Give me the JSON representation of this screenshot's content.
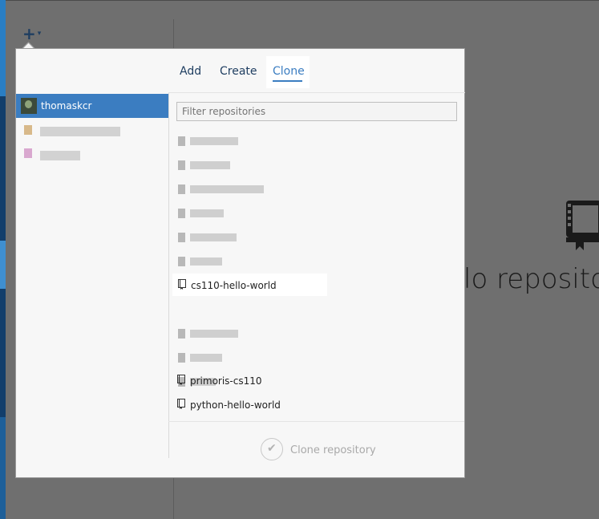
{
  "toolbar": {
    "plus_icon": "+",
    "caret_icon": "▾"
  },
  "background": {
    "partial_text": "lo repositor",
    "icon": "book-icon"
  },
  "tabs": [
    {
      "label": "Add",
      "active": false
    },
    {
      "label": "Create",
      "active": false
    },
    {
      "label": "Clone",
      "active": true
    }
  ],
  "accounts": {
    "active_name": "thomaskcr"
  },
  "filter": {
    "placeholder": "Filter repositories"
  },
  "repositories": {
    "highlighted": "cs110-hello-world",
    "item_2": "primoris-cs110",
    "item_3": "python-hello-world"
  },
  "footer": {
    "clone_button_label": "Clone repository",
    "check_icon": "✔"
  },
  "colors": {
    "accent": "#3b7dc1",
    "dark_blue": "#1f3e61",
    "overlay": "#6f6f6f",
    "panel": "#f7f7f7"
  }
}
